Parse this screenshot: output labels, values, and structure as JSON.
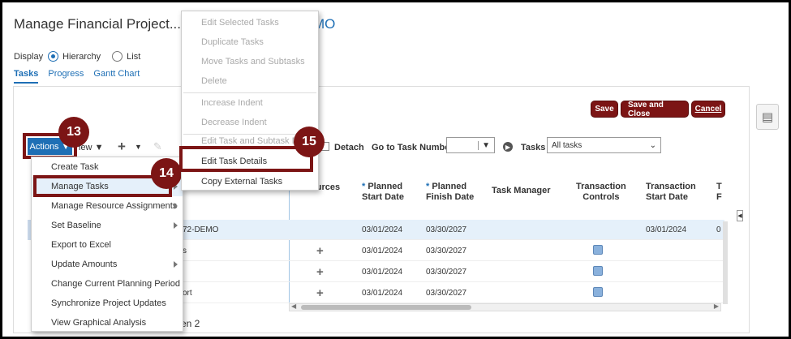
{
  "page": {
    "title": "Manage Financial Project...",
    "title_tail": "MO"
  },
  "display": {
    "label": "Display",
    "option_hierarchy": "Hierarchy",
    "option_list": "List"
  },
  "tabs": [
    "Tasks",
    "Progress",
    "Gantt Chart"
  ],
  "buttons": {
    "save": "Save",
    "save_close": "Save and Close",
    "cancel": "Cancel"
  },
  "toolbar": {
    "actions": "Actions",
    "view": "iew",
    "detach": "Detach",
    "goto_label": "Go to Task Number",
    "tasks_label": "Tasks",
    "tasks_filter": "All tasks"
  },
  "columns": {
    "resources": "ources",
    "planned_start": "Planned\nStart Date",
    "planned_finish": "Planned\nFinish Date",
    "task_manager": "Task Manager",
    "transaction_controls": "Transaction\nControls",
    "transaction_start": "Transaction\nStart Date",
    "overflow": "T\nF"
  },
  "rows": [
    {
      "name": "72-DEMO",
      "start": "03/01/2024",
      "finish": "03/30/2027",
      "txn_start": "03/01/2024",
      "overflow": "0"
    },
    {
      "name": "s",
      "start": "03/01/2024",
      "finish": "03/30/2027"
    },
    {
      "name": "",
      "start": "03/01/2024",
      "finish": "03/30/2027"
    },
    {
      "name": "ort",
      "start": "03/01/2024",
      "finish": "03/30/2027"
    }
  ],
  "pagination": "en 2",
  "actions_menu": [
    "Create Task",
    "Manage Tasks",
    "Manage Resource Assignments",
    "Set Baseline",
    "Export to Excel",
    "Update Amounts",
    "Change Current Planning Period",
    "Synchronize Project Updates",
    "View Graphical Analysis"
  ],
  "submenu": {
    "edit_selected": "Edit Selected Tasks",
    "duplicate": "Duplicate Tasks",
    "move": "Move Tasks and Subtasks",
    "delete": "Delete",
    "increase": "Increase Indent",
    "decrease": "Decrease Indent",
    "edit_subtasks": "Edit Task and Subtask D...",
    "edit_details": "Edit Task Details",
    "copy_external": "Copy External Tasks"
  },
  "callouts": {
    "c13": "13",
    "c14": "14",
    "c15": "15"
  },
  "icons": {
    "panel_toggle": "list-icon",
    "add": "plus-icon",
    "go": "arrow-right-icon"
  },
  "colors": {
    "brand": "#1e6fb5",
    "callout": "#7c1515"
  }
}
